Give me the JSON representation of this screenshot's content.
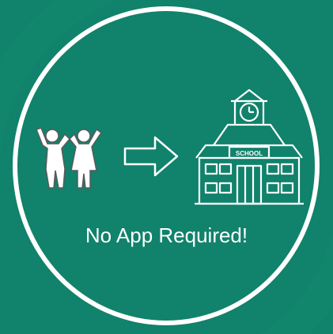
{
  "colors": {
    "background": "#11826b",
    "accent": "#ffffff",
    "background_shape": "#14896f"
  },
  "badge": {
    "tagline": "No App Required!",
    "sign_text": "SCHOOL"
  },
  "icons": {
    "children": "children-icon",
    "arrow": "arrow-right-icon",
    "school": "school-building-icon"
  }
}
